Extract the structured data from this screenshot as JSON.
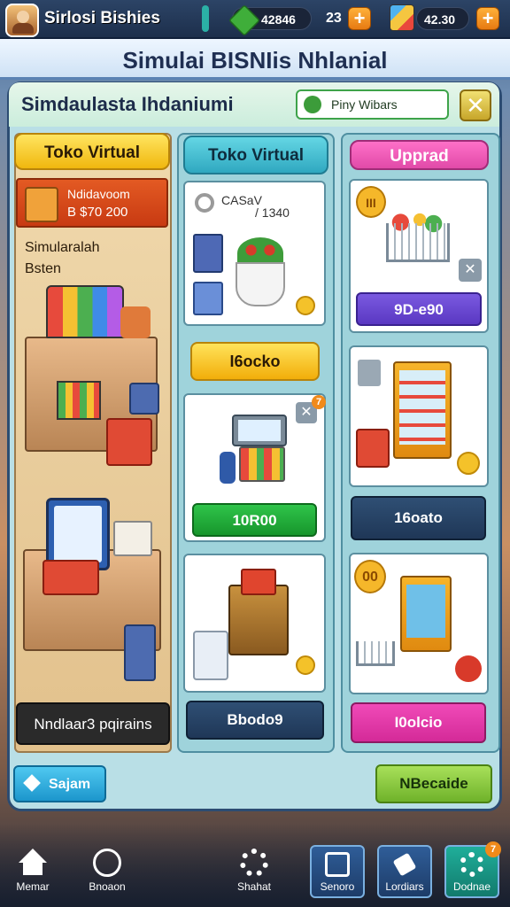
{
  "topbar": {
    "app_title": "Sirlosi Bishies",
    "resource1": {
      "icon": "green-gem-icon",
      "value": "42846",
      "amount": "23"
    },
    "resource2": {
      "icon": "cube-icon",
      "value": "42.30"
    },
    "plus": "+"
  },
  "header": {
    "title": "Simulai BISNIis Nhlanial"
  },
  "panel": {
    "title": "Simdaulasta Ihdaniumi",
    "search": {
      "value": "Piny Wibars"
    },
    "close": "✕"
  },
  "column1": {
    "tab": "Toko Virtual",
    "promo": {
      "line1": "Ndidavoom",
      "line2": "B $70 200"
    },
    "text": [
      "Simularalah",
      "Bsten"
    ],
    "footer_button": "Nndlaar3 pqirains"
  },
  "column2": {
    "tab": "Toko Virtual",
    "card1_label_line1": "CASaV",
    "card1_label_line2": "/ 1340",
    "yellow_button": "I6ocko",
    "green_button": "10R00",
    "navy_button": "Bbodo9",
    "badge": "7"
  },
  "column3": {
    "tab": "Upprad",
    "purple_button": "9D-e90",
    "navy_button": "16oato",
    "coin": "00",
    "magenta_button": "I0olcio",
    "sticker": "III"
  },
  "bottom": {
    "left_button": "Sajam",
    "right_button": "NBecaide"
  },
  "nav": [
    {
      "label": "Memar",
      "icon": "home-icon"
    },
    {
      "label": "Bnoaon",
      "icon": "clock-icon"
    },
    {
      "label": "Shahat",
      "icon": "gear-icon"
    },
    {
      "label": "Senoro",
      "icon": "phone-icon"
    },
    {
      "label": "Lordiars",
      "icon": "hammer-icon"
    },
    {
      "label": "Dodnae",
      "icon": "settings-icon",
      "badge": "7"
    }
  ],
  "colors": {
    "accent_yellow": "#f0b70e",
    "accent_teal": "#2fa8c0",
    "accent_pink": "#e14aa8",
    "accent_green": "#17962c"
  }
}
